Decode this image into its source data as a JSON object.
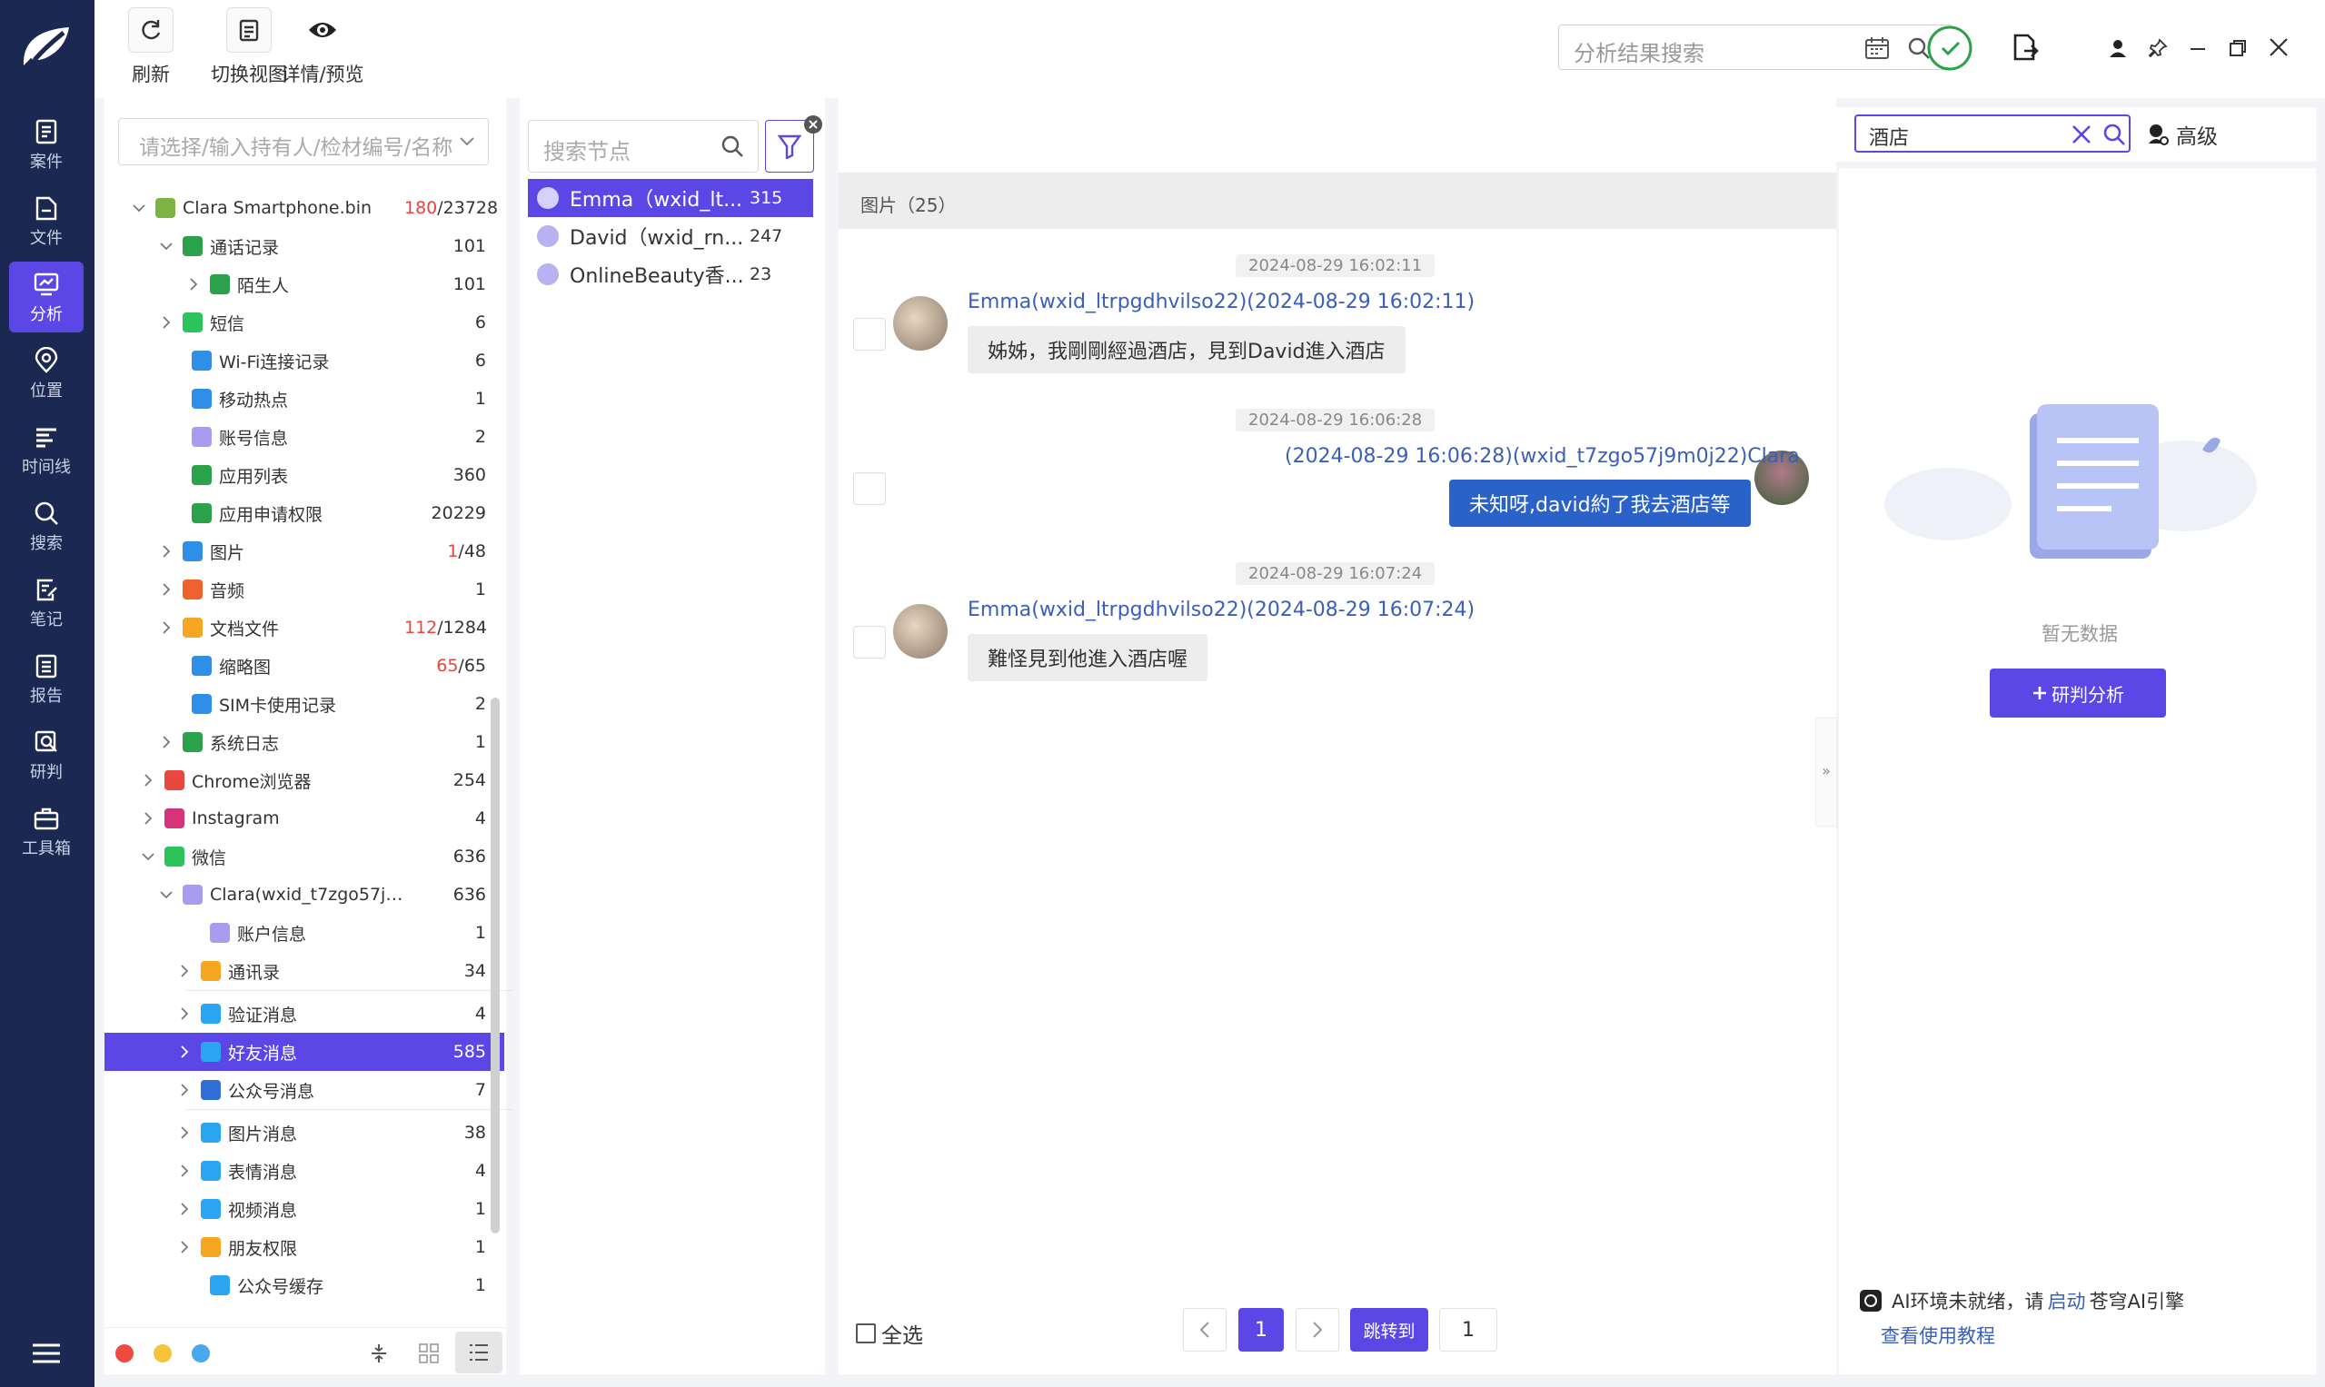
{
  "nav": {
    "items": [
      {
        "id": "case",
        "label": "案件"
      },
      {
        "id": "file",
        "label": "文件"
      },
      {
        "id": "analysis",
        "label": "分析"
      },
      {
        "id": "location",
        "label": "位置"
      },
      {
        "id": "timeline",
        "label": "时间线"
      },
      {
        "id": "search",
        "label": "搜索"
      },
      {
        "id": "notes",
        "label": "笔记"
      },
      {
        "id": "report",
        "label": "报告"
      },
      {
        "id": "judge",
        "label": "研判"
      },
      {
        "id": "toolbox",
        "label": "工具箱"
      }
    ],
    "active": "analysis",
    "accent": "#5b47e6",
    "bg": "#1b2952"
  },
  "toolbar": {
    "refresh": "刷新",
    "switch_view": "切换视图",
    "details": "详情/预览",
    "search_placeholder": "分析结果搜索"
  },
  "tree": {
    "select_placeholder": "请选择/输入持有人/检材编号/名称",
    "root": {
      "label": "Clara Smartphone.bin",
      "count_hit": "180",
      "count_total": "/23728"
    },
    "rows": [
      {
        "label": "通话记录",
        "count": "101"
      },
      {
        "label": "陌生人",
        "count": "101"
      },
      {
        "label": "短信",
        "count": "6"
      },
      {
        "label": "Wi-Fi连接记录",
        "count": "6"
      },
      {
        "label": "移动热点",
        "count": "1"
      },
      {
        "label": "账号信息",
        "count": "2"
      },
      {
        "label": "应用列表",
        "count": "360"
      },
      {
        "label": "应用申请权限",
        "count": "20229"
      },
      {
        "label": "图片",
        "hit": "1",
        "count": "/48"
      },
      {
        "label": "音频",
        "count": "1"
      },
      {
        "label": "文档文件",
        "hit": "112",
        "count": "/1284"
      },
      {
        "label": "缩略图",
        "hit": "65",
        "count": "/65"
      },
      {
        "label": "SIM卡使用记录",
        "count": "2"
      },
      {
        "label": "系统日志",
        "count": "1"
      },
      {
        "label": "Chrome浏览器",
        "count": "254"
      },
      {
        "label": "Instagram",
        "count": "4"
      },
      {
        "label": "微信",
        "count": "636"
      },
      {
        "label": "Clara(wxid_t7zgo57j9...",
        "count": "636"
      },
      {
        "label": "账户信息",
        "count": "1"
      },
      {
        "label": "通讯录",
        "count": "34"
      },
      {
        "label": "验证消息",
        "count": "4"
      },
      {
        "label": "好友消息",
        "count": "585"
      },
      {
        "label": "公众号消息",
        "count": "7"
      },
      {
        "label": "图片消息",
        "count": "38"
      },
      {
        "label": "表情消息",
        "count": "4"
      },
      {
        "label": "视频消息",
        "count": "1"
      },
      {
        "label": "朋友权限",
        "count": "1"
      },
      {
        "label": "公众号缓存",
        "count": "1"
      }
    ]
  },
  "nodes": {
    "search_placeholder": "搜索节点",
    "items": [
      {
        "name": "Emma（wxid_lt...",
        "count": "315"
      },
      {
        "name": "David（wxid_rn...",
        "count": "247"
      },
      {
        "name": "OnlineBeauty香...",
        "count": "23"
      }
    ]
  },
  "tabs": {
    "tag": "酒店",
    "search_value": "酒店",
    "advanced": "高级"
  },
  "chat": {
    "header": "图片（25）",
    "messages": [
      {
        "time": "2024-08-29 16:02:11",
        "meta": "Emma(wxid_ltrpgdhvilso22)(2024-08-29 16:02:11)",
        "text": "姊姊，我剛剛經過酒店，見到David進入酒店",
        "side": "left"
      },
      {
        "time": "2024-08-29 16:06:28",
        "meta": "(2024-08-29 16:06:28)(wxid_t7zgo57j9m0j22)Clara",
        "text": "未知呀,david約了我去酒店等",
        "side": "right"
      },
      {
        "time": "2024-08-29 16:07:24",
        "meta": "Emma(wxid_ltrpgdhvilso22)(2024-08-29 16:07:24)",
        "text": "難怪見到他進入酒店喔",
        "side": "left"
      }
    ],
    "select_all": "全选",
    "page": "1",
    "jump": "跳转到",
    "jump_value": "1"
  },
  "right": {
    "empty": "暂无数据",
    "analyze": "研判分析",
    "ai_prefix": "AI环境未就绪，请",
    "ai_link": "启动",
    "ai_suffix": "苍穹AI引擎",
    "tutorial": "查看使用教程"
  }
}
